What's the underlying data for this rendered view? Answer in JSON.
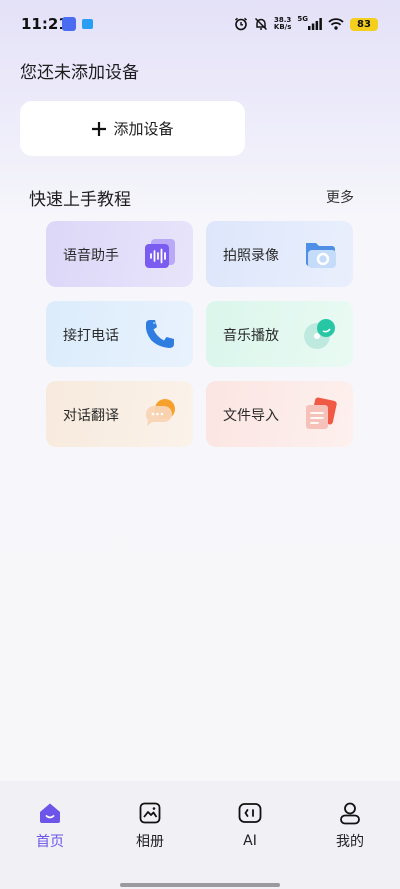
{
  "status_bar": {
    "time": "11:21",
    "net_speed_value": "38.3",
    "net_speed_unit": "KB/s",
    "network": "5G",
    "battery": "83"
  },
  "header": {
    "title": "您还未添加设备"
  },
  "add_device": {
    "label": "添加设备"
  },
  "tutorials": {
    "title": "快速上手教程",
    "more": "更多",
    "items": [
      {
        "label": "语音助手",
        "icon": "voice-assistant-icon"
      },
      {
        "label": "拍照录像",
        "icon": "camera-folder-icon"
      },
      {
        "label": "接打电话",
        "icon": "phone-icon"
      },
      {
        "label": "音乐播放",
        "icon": "music-disc-icon"
      },
      {
        "label": "对话翻译",
        "icon": "chat-translate-icon"
      },
      {
        "label": "文件导入",
        "icon": "file-import-icon"
      }
    ]
  },
  "tab_bar": {
    "items": [
      {
        "label": "首页",
        "icon": "home-icon",
        "active": true
      },
      {
        "label": "相册",
        "icon": "album-icon",
        "active": false
      },
      {
        "label": "AI",
        "icon": "ai-face-icon",
        "active": false
      },
      {
        "label": "我的",
        "icon": "profile-icon",
        "active": false
      }
    ]
  },
  "colors": {
    "accent": "#6c55e8",
    "battery": "#f4cf1c"
  }
}
